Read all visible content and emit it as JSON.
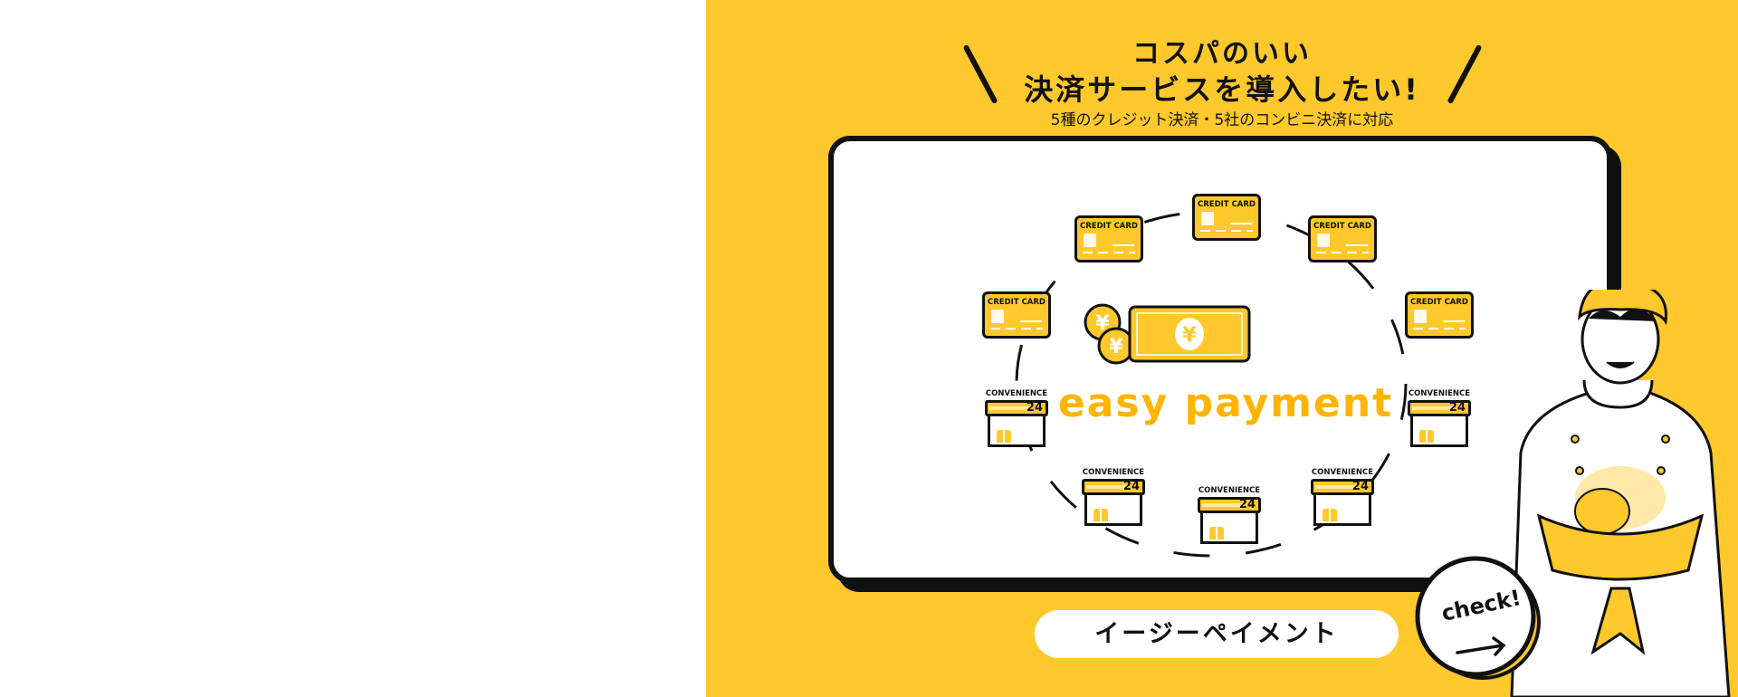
{
  "headline": {
    "line1": "コスパのいい",
    "line2": "決済サービスを導入したい!",
    "sub": "5種のクレジット決済・5社のコンビニ決済に対応"
  },
  "board": {
    "credit_card_label": "CREDIT CARD",
    "store_label": "CONVENIENCE",
    "store_number": "24",
    "brand_text": "easy payment",
    "currency_symbol": "¥"
  },
  "cta": {
    "label": "イージーペイメント",
    "check_label": "check!"
  },
  "colors": {
    "accent": "#FFC82C",
    "brand_text": "#FFB400",
    "outline": "#111111"
  }
}
